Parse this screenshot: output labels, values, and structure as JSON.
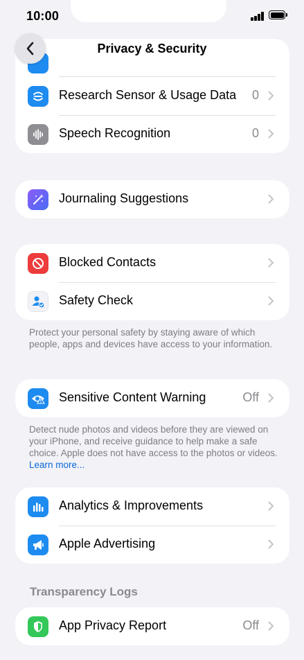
{
  "status_bar": {
    "time": "10:00"
  },
  "nav": {
    "title": "Privacy & Security"
  },
  "group1": {
    "rows": [
      {
        "label": "Research Sensor & Usage Data",
        "value": "0",
        "icon": "research-sensor-icon",
        "color": "#1e8bf0"
      },
      {
        "label": "Speech Recognition",
        "value": "0",
        "icon": "waveform-icon",
        "color": "#8e8e93"
      }
    ]
  },
  "group2": {
    "rows": [
      {
        "label": "Journaling Suggestions",
        "icon": "magic-wand-icon",
        "color": "#6b4cf0"
      }
    ]
  },
  "group3": {
    "rows": [
      {
        "label": "Blocked Contacts",
        "icon": "blocked-icon",
        "color": "#ee3b3b"
      },
      {
        "label": "Safety Check",
        "icon": "person-check-icon",
        "color": "#f2f2f7"
      }
    ],
    "footer": "Protect your personal safety by staying aware of which people, apps and devices have access to your information."
  },
  "group4": {
    "rows": [
      {
        "label": "Sensitive Content Warning",
        "value": "Off",
        "icon": "eye-warning-icon",
        "color": "#1e8bf0"
      }
    ],
    "footer": "Detect nude photos and videos before they are viewed on your iPhone, and receive guidance to help make a safe choice. Apple does not have access to the photos or videos.",
    "footer_link": "Learn more..."
  },
  "group5": {
    "rows": [
      {
        "label": "Analytics & Improvements",
        "icon": "bar-chart-icon",
        "color": "#1e8bf0"
      },
      {
        "label": "Apple Advertising",
        "icon": "megaphone-icon",
        "color": "#1e8bf0"
      }
    ]
  },
  "transparency": {
    "header": "Transparency Logs",
    "rows": [
      {
        "label": "App Privacy Report",
        "value": "Off",
        "icon": "shield-icon",
        "color": "#34c759"
      }
    ]
  }
}
